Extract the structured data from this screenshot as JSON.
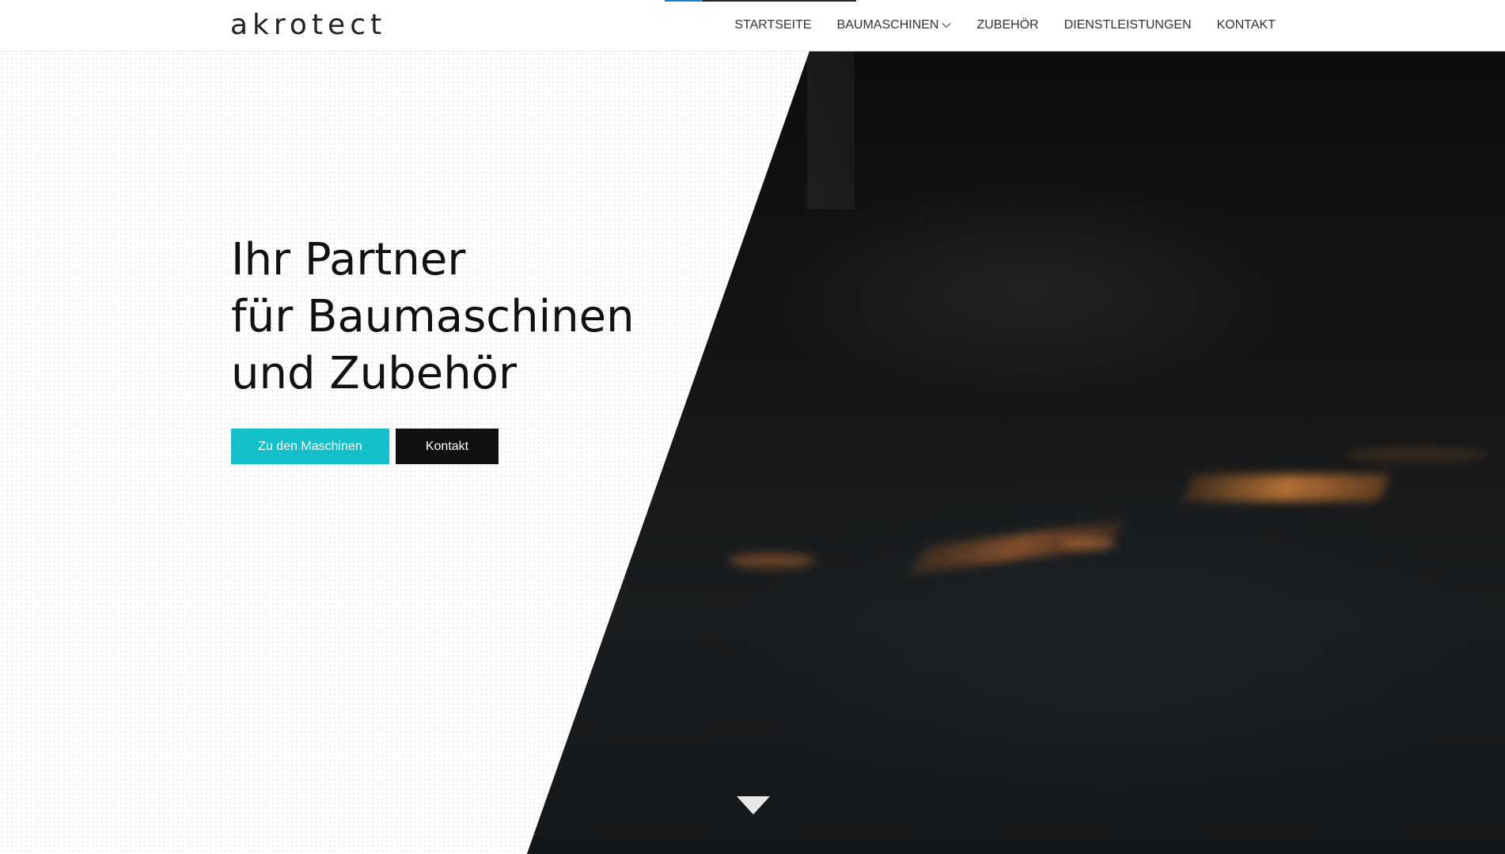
{
  "header": {
    "logo": "akrotect",
    "nav": [
      {
        "label": "STARTSEITE"
      },
      {
        "label": "BAUMASCHINEN",
        "has_dropdown": true
      },
      {
        "label": "ZUBEHÖR"
      },
      {
        "label": "DIENSTLEISTUNGEN"
      },
      {
        "label": "KONTAKT"
      }
    ]
  },
  "hero": {
    "title_lines": [
      "Ihr Partner",
      "für Baumaschinen",
      "und Zubehör"
    ],
    "primary_button": "Zu den Maschinen",
    "secondary_button": "Kontakt",
    "scroll_icon": "chevron-down-triangle-icon"
  },
  "colors": {
    "accent": "#13bfc9",
    "dark_button": "#111111",
    "hero_dark": "#0d0e0e",
    "indicator_accent": "#1f7fd1"
  }
}
